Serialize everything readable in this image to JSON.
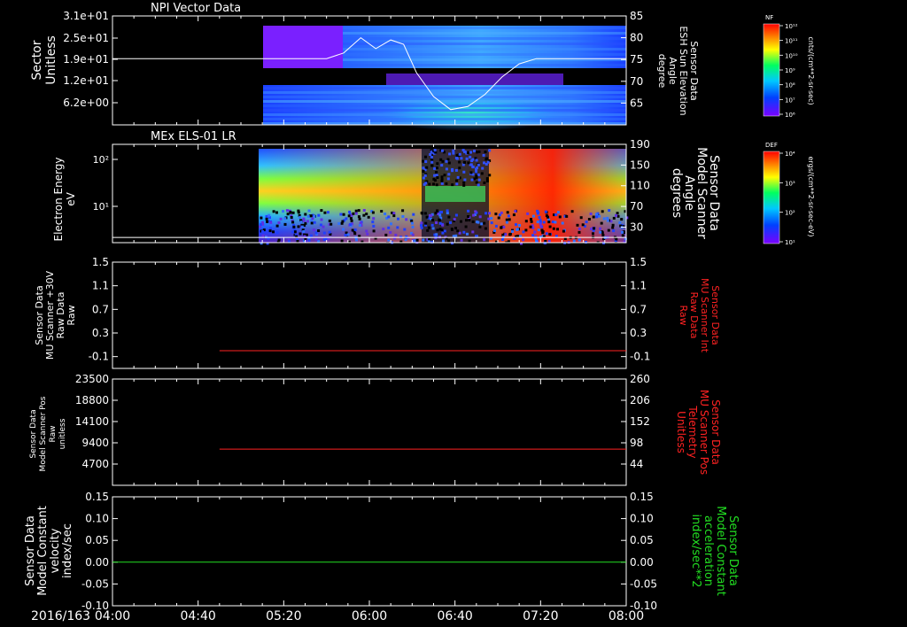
{
  "figure": {
    "date_label": "2016/163",
    "time_ticks": [
      "04:00",
      "04:40",
      "05:20",
      "06:00",
      "06:40",
      "07:20",
      "08:00"
    ]
  },
  "colors": {
    "background": "#000000",
    "axis": "#ffffff",
    "red_trace": "#ff2222",
    "green_trace": "#22dd22"
  },
  "chart_data": [
    {
      "id": "panel1",
      "type": "heatmap",
      "title": "NPI Vector Data",
      "ylabel_left": [
        "Sector",
        "Unitless"
      ],
      "ylabel_right": [
        "Sensor Data",
        "ESH Sun Elevation",
        "Angle",
        "degree"
      ],
      "yticks_left": [
        "3.1e+01",
        "2.5e+01",
        "1.9e+01",
        "1.2e+01",
        "6.2e+00"
      ],
      "yticks_right": [
        "85",
        "80",
        "75",
        "70",
        "65"
      ],
      "ylim_right": [
        60,
        85
      ],
      "data_start": "05:00",
      "colorbar": {
        "label": "NF",
        "ticks": [
          "10¹²",
          "10¹¹",
          "10¹⁰",
          "10⁹",
          "10⁸",
          "10⁷",
          "10⁶"
        ],
        "units": "cnts/(cm**2-sr-sec)"
      },
      "line_series": {
        "name": "ESH Sun Elevation Angle",
        "x": [
          "04:00",
          "05:00",
          "05:40",
          "05:48",
          "05:56",
          "06:03",
          "06:10",
          "06:16",
          "06:22",
          "06:30",
          "06:38",
          "06:46",
          "06:54",
          "07:02",
          "07:10",
          "07:18",
          "08:00"
        ],
        "y": [
          75.2,
          75.2,
          75.2,
          76.5,
          80,
          77.5,
          79.5,
          78.5,
          72,
          66.5,
          63.5,
          64.2,
          67,
          71,
          74,
          75.2,
          75.2
        ]
      }
    },
    {
      "id": "panel2",
      "type": "heatmap",
      "title": "MEx ELS-01 LR",
      "ylabel_left": [
        "Electron Energy",
        "eV"
      ],
      "ylabel_right": [
        "Sensor Data",
        "Model Scanner",
        "Angle",
        "degrees"
      ],
      "yticks_left": [
        "10²",
        "10¹"
      ],
      "yticks_right": [
        "190",
        "150",
        "110",
        "70",
        "30"
      ],
      "ylim_right": [
        0,
        190
      ],
      "data_start": "04:58",
      "colorbar": {
        "label": "DEF",
        "ticks": [
          "10⁴",
          "10³",
          "10²",
          "10¹"
        ],
        "units": "ergs/(cm**2-sr-sec-eV)"
      },
      "line_series": {
        "name": "Model Scanner Angle",
        "x": [
          "04:00",
          "08:00"
        ],
        "y": [
          10,
          10
        ]
      }
    },
    {
      "id": "panel3",
      "type": "line",
      "ylabel_left": [
        "Sensor Data",
        "MU Scanner +30V",
        "Raw Data",
        "Raw"
      ],
      "ylabel_right": [
        "Sensor Data",
        "MU Scanner Int",
        "Raw Data",
        "Raw"
      ],
      "yticks_left": [
        "1.5",
        "1.1",
        "0.7",
        "0.3",
        "-0.1"
      ],
      "yticks_right": [
        "1.5",
        "1.1",
        "0.7",
        "0.3",
        "-0.1"
      ],
      "ylim": [
        -0.3,
        1.5
      ],
      "series": [
        {
          "x": [
            "04:50",
            "08:00"
          ],
          "y": [
            0.0,
            0.0
          ],
          "color": "#ff2222"
        }
      ]
    },
    {
      "id": "panel4",
      "type": "line",
      "ylabel_left": [
        "Sensor Data",
        "Model Scanner Pos",
        "Raw",
        "unitless"
      ],
      "ylabel_right": [
        "Sensor Data",
        "MU Scanner Pos",
        "Telemetry",
        "Unitless"
      ],
      "yticks_left": [
        "23500",
        "18800",
        "14100",
        "9400",
        "4700"
      ],
      "yticks_right": [
        "260",
        "206",
        "152",
        "98",
        "44"
      ],
      "ylim": [
        0,
        23500
      ],
      "series": [
        {
          "x": [
            "04:50",
            "08:00"
          ],
          "y": [
            8000,
            8000
          ],
          "color": "#ff2222"
        }
      ]
    },
    {
      "id": "panel5",
      "type": "line",
      "ylabel_left": [
        "Sensor Data",
        "Model Constant",
        "velocity",
        "index/sec"
      ],
      "ylabel_right": [
        "Sensor Data",
        "Model Constant",
        "acceleration",
        "index/sec**2"
      ],
      "yticks_left": [
        "0.15",
        "0.10",
        "0.05",
        "0.00",
        "-0.05",
        "-0.10"
      ],
      "yticks_right": [
        "0.15",
        "0.10",
        "0.05",
        "0.00",
        "-0.05",
        "-0.10"
      ],
      "ylim": [
        -0.1,
        0.15
      ],
      "series": [
        {
          "x": [
            "04:00",
            "08:00"
          ],
          "y": [
            0.0,
            0.0
          ],
          "color": "#22dd22"
        }
      ]
    }
  ]
}
